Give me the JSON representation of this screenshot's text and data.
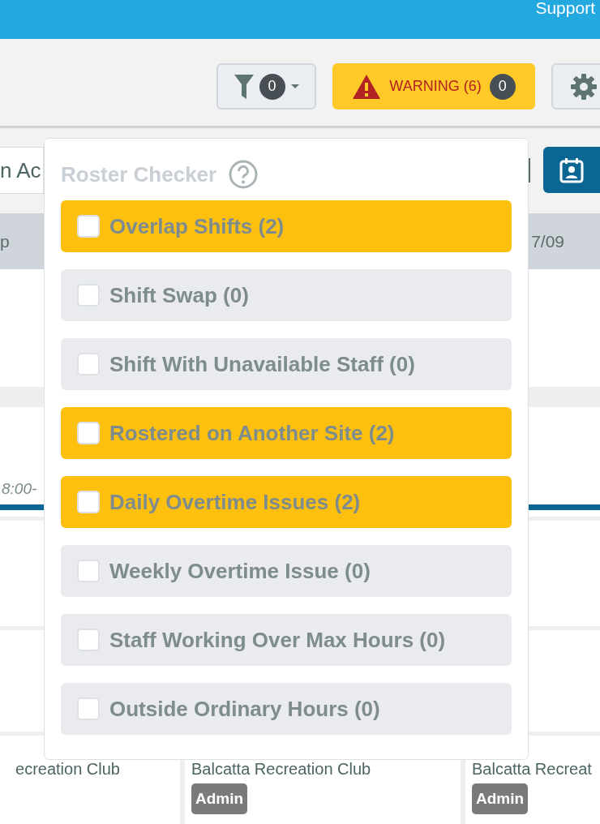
{
  "header": {
    "link": "Support"
  },
  "toolbar": {
    "filter": {
      "count": "0"
    },
    "warning": {
      "label": "WARNING (6)",
      "count": "0"
    }
  },
  "search": {
    "value": "n Ac"
  },
  "day_headers": [
    "p",
    "7/09"
  ],
  "shift": {
    "time": "8:00-"
  },
  "cards": [
    {
      "site": "ecreation Club"
    },
    {
      "site": "Balcatta Recreation Club",
      "role": "Admin"
    },
    {
      "site": "Balcatta Recreat",
      "role": "Admin"
    }
  ],
  "roster_checker": {
    "title": "Roster Checker",
    "items": [
      {
        "label": "Overlap Shifts (2)",
        "checked": false,
        "flagged": true
      },
      {
        "label": "Shift Swap (0)",
        "checked": false,
        "flagged": false
      },
      {
        "label": "Shift With Unavailable Staff (0)",
        "checked": false,
        "flagged": false
      },
      {
        "label": "Rostered on Another Site (2)",
        "checked": false,
        "flagged": true
      },
      {
        "label": "Daily Overtime Issues (2)",
        "checked": false,
        "flagged": true
      },
      {
        "label": "Weekly Overtime Issue (0)",
        "checked": false,
        "flagged": false
      },
      {
        "label": "Staff Working Over Max Hours (0)",
        "checked": false,
        "flagged": false
      },
      {
        "label": "Outside Ordinary Hours (0)",
        "checked": false,
        "flagged": false
      }
    ]
  }
}
